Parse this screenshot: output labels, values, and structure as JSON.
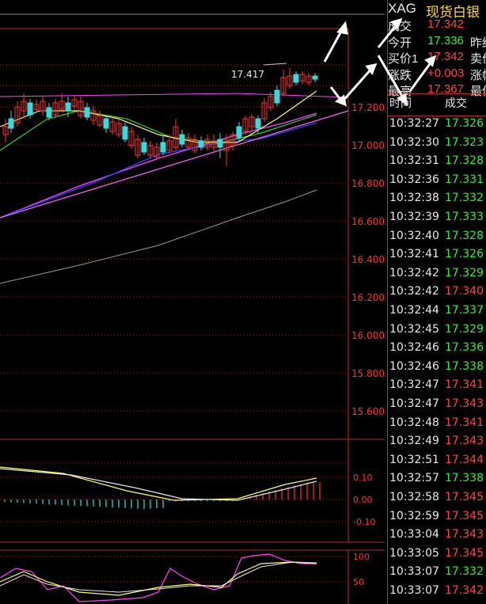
{
  "symbol": "XAG",
  "name": "现货白银",
  "quote": [
    {
      "label": "成交",
      "value": "17.342",
      "color": "red",
      "extra": ""
    },
    {
      "label": "今开",
      "value": "17.336",
      "color": "green",
      "extra": "昨结"
    },
    {
      "label": "买价1",
      "value": "17.342",
      "color": "red",
      "extra": "卖价"
    },
    {
      "label": "涨跌",
      "value": "+0.003",
      "color": "red",
      "extra": "涨幅"
    },
    {
      "label": "最高",
      "value": "17.367",
      "color": "red",
      "extra": "最低"
    }
  ],
  "trade_header": {
    "time": "时间",
    "price": "成交"
  },
  "trades": [
    {
      "time": "10:32:27",
      "price": "17.326",
      "color": "green"
    },
    {
      "time": "10:32:30",
      "price": "17.323",
      "color": "green"
    },
    {
      "time": "10:32:31",
      "price": "17.328",
      "color": "green"
    },
    {
      "time": "10:32:36",
      "price": "17.331",
      "color": "green"
    },
    {
      "time": "10:32:38",
      "price": "17.332",
      "color": "green"
    },
    {
      "time": "10:32:39",
      "price": "17.333",
      "color": "green"
    },
    {
      "time": "10:32:40",
      "price": "17.328",
      "color": "green"
    },
    {
      "time": "10:32:41",
      "price": "17.326",
      "color": "green"
    },
    {
      "time": "10:32:42",
      "price": "17.329",
      "color": "green"
    },
    {
      "time": "10:32:42",
      "price": "17.340",
      "color": "red"
    },
    {
      "time": "10:32:44",
      "price": "17.337",
      "color": "green"
    },
    {
      "time": "10:32:45",
      "price": "17.329",
      "color": "green"
    },
    {
      "time": "10:32:46",
      "price": "17.336",
      "color": "green"
    },
    {
      "time": "10:32:46",
      "price": "17.338",
      "color": "green"
    },
    {
      "time": "10:32:47",
      "price": "17.341",
      "color": "red"
    },
    {
      "time": "10:32:47",
      "price": "17.343",
      "color": "red"
    },
    {
      "time": "10:32:48",
      "price": "17.341",
      "color": "red"
    },
    {
      "time": "10:32:49",
      "price": "17.343",
      "color": "red"
    },
    {
      "time": "10:32:51",
      "price": "17.344",
      "color": "red"
    },
    {
      "time": "10:32:57",
      "price": "17.338",
      "color": "green"
    },
    {
      "time": "10:32:58",
      "price": "17.345",
      "color": "red"
    },
    {
      "time": "10:32:59",
      "price": "17.345",
      "color": "red"
    },
    {
      "time": "10:33:04",
      "price": "17.343",
      "color": "red"
    },
    {
      "time": "10:33:05",
      "price": "17.345",
      "color": "red"
    },
    {
      "time": "10:33:07",
      "price": "17.332",
      "color": "green"
    },
    {
      "time": "10:33:07",
      "price": "17.342",
      "color": "red"
    }
  ],
  "chart": {
    "price_ticks": [
      "17.200",
      "17.000",
      "16.800",
      "16.600",
      "16.400",
      "16.200",
      "16.000",
      "15.800",
      "15.600"
    ],
    "price_values": [
      17.2,
      17.0,
      16.8,
      16.6,
      16.4,
      16.2,
      16.0,
      15.8,
      15.6
    ],
    "high_label": "17.417",
    "macd_ticks": [
      "0.10",
      "0.00",
      "-0.10"
    ],
    "kdj_ticks": [
      "100",
      "50"
    ],
    "colors": {
      "up": "#ff3333",
      "down": "#33dddd",
      "grid": "#b03030",
      "axis_text": "#ff3333"
    }
  }
}
